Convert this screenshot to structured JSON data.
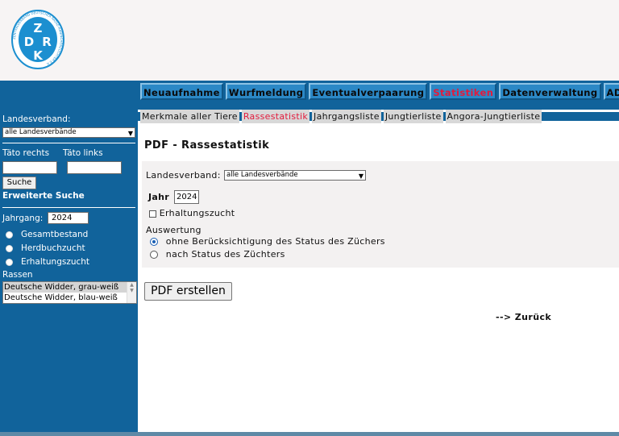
{
  "logo": {
    "letters": [
      "Z",
      "D",
      "R",
      "K"
    ],
    "ring_text": "ZENTRALVERBAND DEUTSCHER RASSE-KANINCHENZÜCHTER E.V."
  },
  "topnav": [
    {
      "label": "Neuaufnahme",
      "active": false
    },
    {
      "label": "Wurfmeldung",
      "active": false
    },
    {
      "label": "Eventualverpaarung",
      "active": false
    },
    {
      "label": "Statistiken",
      "active": true
    },
    {
      "label": "Datenverwaltung",
      "active": false
    },
    {
      "label": "ADMIN",
      "active": false
    }
  ],
  "sidebar": {
    "landesverband_label": "Landesverband:",
    "landesverband_value": "alle Landesverbände",
    "taeto_rechts_label": "Täto rechts",
    "taeto_links_label": "Täto links",
    "taeto_rechts_value": "",
    "taeto_links_value": "",
    "search_button": "Suche",
    "advanced_search": "Erweiterte Suche",
    "jahrgang_label": "Jahrgang:",
    "jahrgang_value": "2024",
    "options": [
      "Gesamtbestand",
      "Herdbuchzucht",
      "Erhaltungszucht"
    ],
    "rassen_label": "Rassen",
    "rassen_list": [
      "Deutsche Widder, grau-weiß",
      "Deutsche Widder, blau-weiß"
    ]
  },
  "subnav": [
    {
      "label": "Merkmale aller Tiere",
      "active": false
    },
    {
      "label": "Rassestatistik",
      "active": true
    },
    {
      "label": "Jahrgangsliste",
      "active": false
    },
    {
      "label": "Jungtierliste",
      "active": false
    },
    {
      "label": "Angora-Jungtierliste",
      "active": false
    }
  ],
  "main": {
    "title": "PDF - Rassestatistik",
    "landesverband_label": "Landesverband:",
    "landesverband_value": "alle Landesverbände",
    "jahr_label": "Jahr",
    "jahr_value": "2024",
    "erhaltungszucht_label": "Erhaltungszucht",
    "auswertung_label": "Auswertung",
    "auswertung_options": [
      {
        "label": "ohne Berücksichtigung des Status des Züchers",
        "selected": true
      },
      {
        "label": "nach Status des Züchters",
        "selected": false
      }
    ],
    "create_button": "PDF erstellen",
    "back_link": "--> Zurück"
  },
  "colors": {
    "blue": "#11639b",
    "nav_button": "#2b88c6",
    "active_red": "#e21b3c"
  }
}
